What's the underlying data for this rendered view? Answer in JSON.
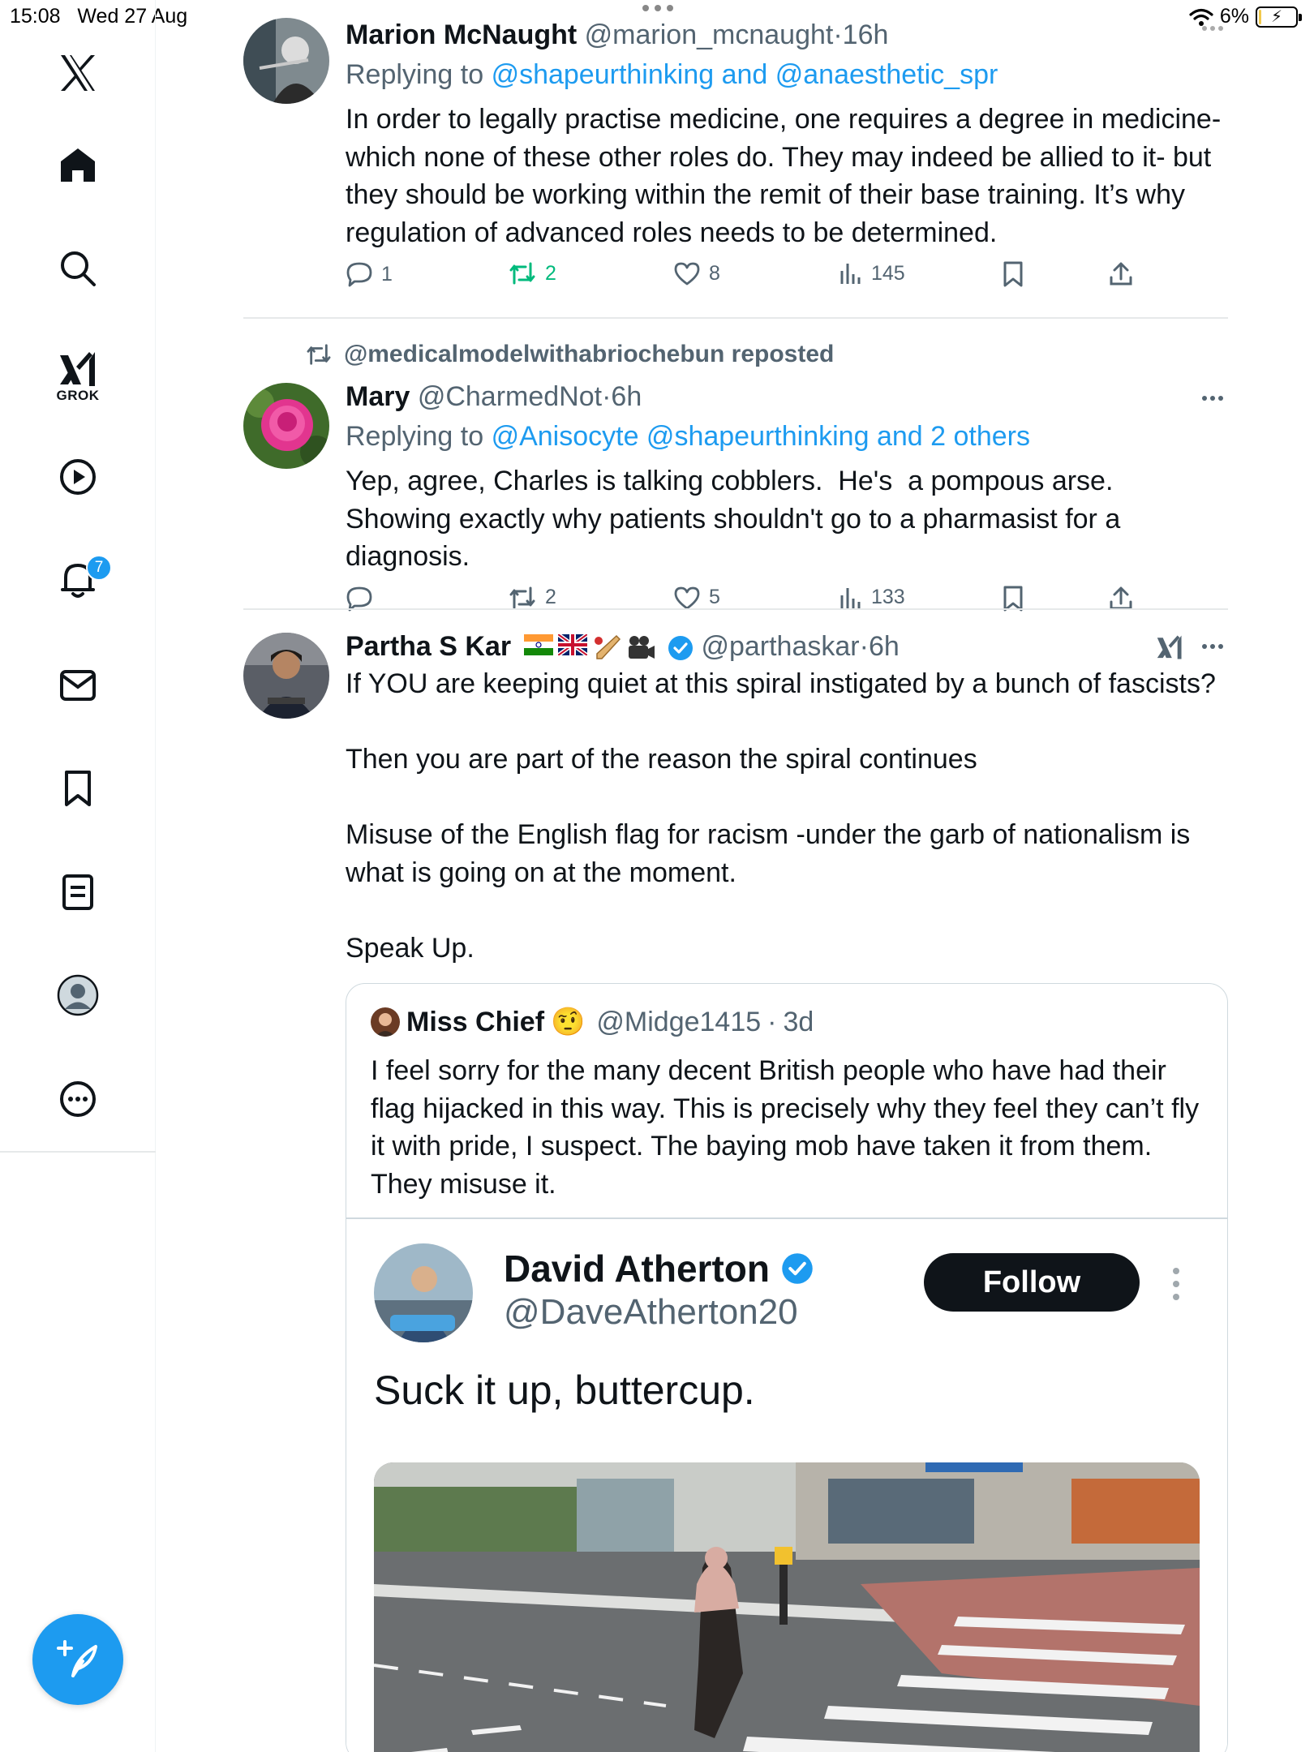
{
  "status_bar": {
    "time": "15:08",
    "date": "Wed 27 Aug",
    "battery": "6%",
    "battery_level": 0.06
  },
  "sidebar": {
    "grok_label": "GROK",
    "notifications_badge": "7",
    "items": [
      {
        "name": "x-logo-icon"
      },
      {
        "name": "home-icon"
      },
      {
        "name": "search-icon"
      },
      {
        "name": "grok-icon"
      },
      {
        "name": "video-icon"
      },
      {
        "name": "notifications-icon"
      },
      {
        "name": "messages-icon"
      },
      {
        "name": "bookmarks-icon"
      },
      {
        "name": "lists-icon"
      },
      {
        "name": "profile-icon"
      },
      {
        "name": "more-icon"
      }
    ],
    "compose_icon": "compose-post-icon"
  },
  "tweets": [
    {
      "name": "Marion McNaught",
      "handle": "@marion_mcnaught",
      "sep": "·",
      "time": "16h",
      "reply_prefix": "Replying to",
      "reply_to": "@shapeurthinking and @anaesthetic_spr",
      "text": "In order to legally practise medicine, one requires a degree in medicine- which none of these other roles do. They may indeed be allied to it- but they should be working within the remit of their base training. It’s why regulation of advanced roles needs to be determined.",
      "replies": "1",
      "reposts": "2",
      "likes": "8",
      "views": "145",
      "reposted_by_viewer": true
    },
    {
      "repost_label": "@medicalmodelwithabriochebun reposted",
      "name": "Mary",
      "handle": "@CharmedNot",
      "sep": "·",
      "time": "6h",
      "reply_prefix": "Replying to",
      "reply_to": "@Anisocyte @shapeurthinking and 2 others",
      "text": "Yep, agree, Charles is talking cobblers.  He's  a pompous arse.  Showing exactly why patients shouldn't go to a pharmasist for a diagnosis.",
      "replies": "",
      "reposts": "2",
      "likes": "5",
      "views": "133"
    },
    {
      "name": "Partha S Kar",
      "handle": "@parthaskar",
      "sep": "·",
      "time": "6h",
      "text": "If YOU are keeping quiet at this spiral instigated by a bunch of fascists?\n\nThen you are part of the reason the spiral continues\n\nMisuse of the English flag for racism -under the garb of nationalism is what is going on at the moment.\n\nSpeak Up.",
      "verified": true
    }
  ],
  "quoted_tweet": {
    "name": "Miss Chief",
    "emoji": "🤨",
    "handle": "@Midge1415",
    "sep": "·",
    "time": "3d",
    "text": "I feel sorry for the many decent British people who have had their flag hijacked in this way. This is precisely why they feel they can’t fly it with pride, I suspect. The baying mob have taken it from them. They misuse it."
  },
  "embedded_tweet": {
    "name": "David Atherton",
    "handle": "@DaveAtherton20",
    "follow_label": "Follow",
    "text": "Suck it up, buttercup.",
    "verified": true
  },
  "colors": {
    "accent": "#1d9bf0",
    "repost_green": "#00ba7c",
    "text": "#0f1419",
    "muted": "#536471"
  }
}
